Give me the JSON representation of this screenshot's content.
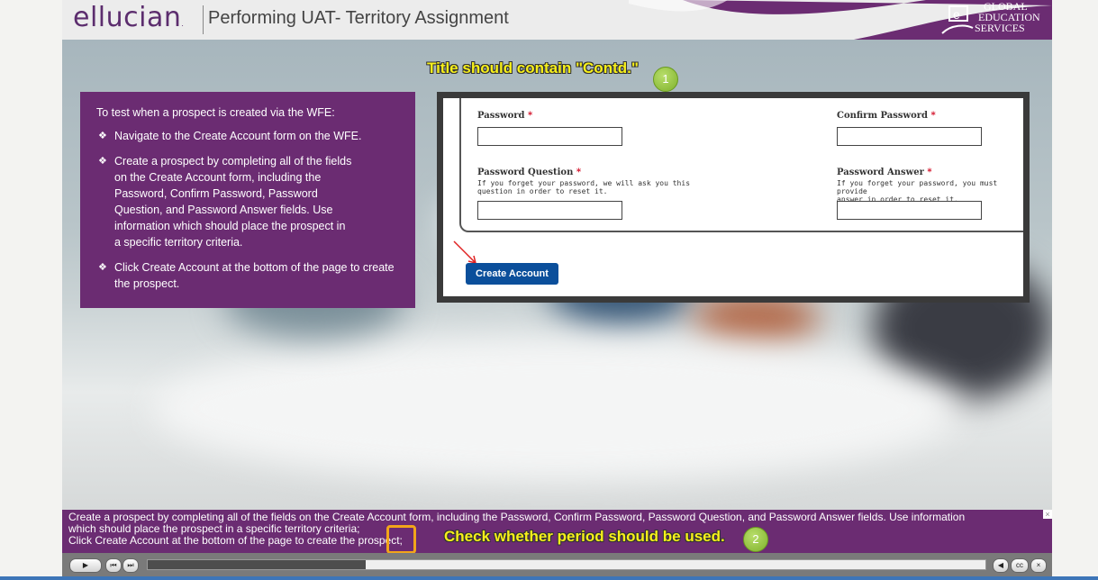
{
  "header": {
    "logo_text": "ellucian",
    "logo_mark": ".",
    "course_title": "Performing UAT- Territory Assignment",
    "ges_logo_lines": [
      "GLOBAL",
      "EDUCATION",
      "SERVICES"
    ]
  },
  "instructions": {
    "intro": "To test when a prospect is created via the WFE:",
    "bullets": [
      "Navigate to the Create Account form on the WFE.",
      "Create a prospect by completing all of the fields on the Create Account form, including the Password, Confirm Password, Password Question, and Password Answer fields. Use information which should place the prospect in a specific territory criteria.",
      "Click Create Account at the bottom of the page to create the prospect."
    ]
  },
  "annotations": {
    "note1": "Title should contain \"Contd.\"",
    "note1_number": "1",
    "note2": "Check whether period should be used.",
    "note2_number": "2"
  },
  "form": {
    "password_label": "Password",
    "confirm_password_label": "Confirm Password",
    "password_question_label": "Password Question",
    "password_question_hint_line1": "If you forget your password, we will ask you this",
    "password_question_hint_line2": "question in order to reset it.",
    "password_answer_label": "Password Answer",
    "password_answer_hint_line1": "If you forget your password, you must provide",
    "password_answer_hint_line2": "answer in order to reset it.",
    "required_marker": "*",
    "create_account_label": "Create Account"
  },
  "caption": {
    "line1": "Create a prospect by completing all of the fields on the Create Account form, including the Password, Confirm Password, Password Question, and Password Answer fields. Use information",
    "line2": "which should place the prospect in a specific territory criteria;",
    "line3": "Click Create Account at the bottom of the page to create the prospect;",
    "close_glyph": "×"
  },
  "player": {
    "play_glyph": "▶",
    "rewind_glyph": "⏮",
    "forward_glyph": "⏭",
    "prev_glyph": "◀",
    "cc_label": "cc",
    "close_glyph": "×",
    "progress_percent": 26
  },
  "colors": {
    "brand_purple": "#6b2c72",
    "annotation_yellow": "#f7f01a",
    "button_blue": "#0b4f9b",
    "highlight_orange": "#f2a51a"
  }
}
